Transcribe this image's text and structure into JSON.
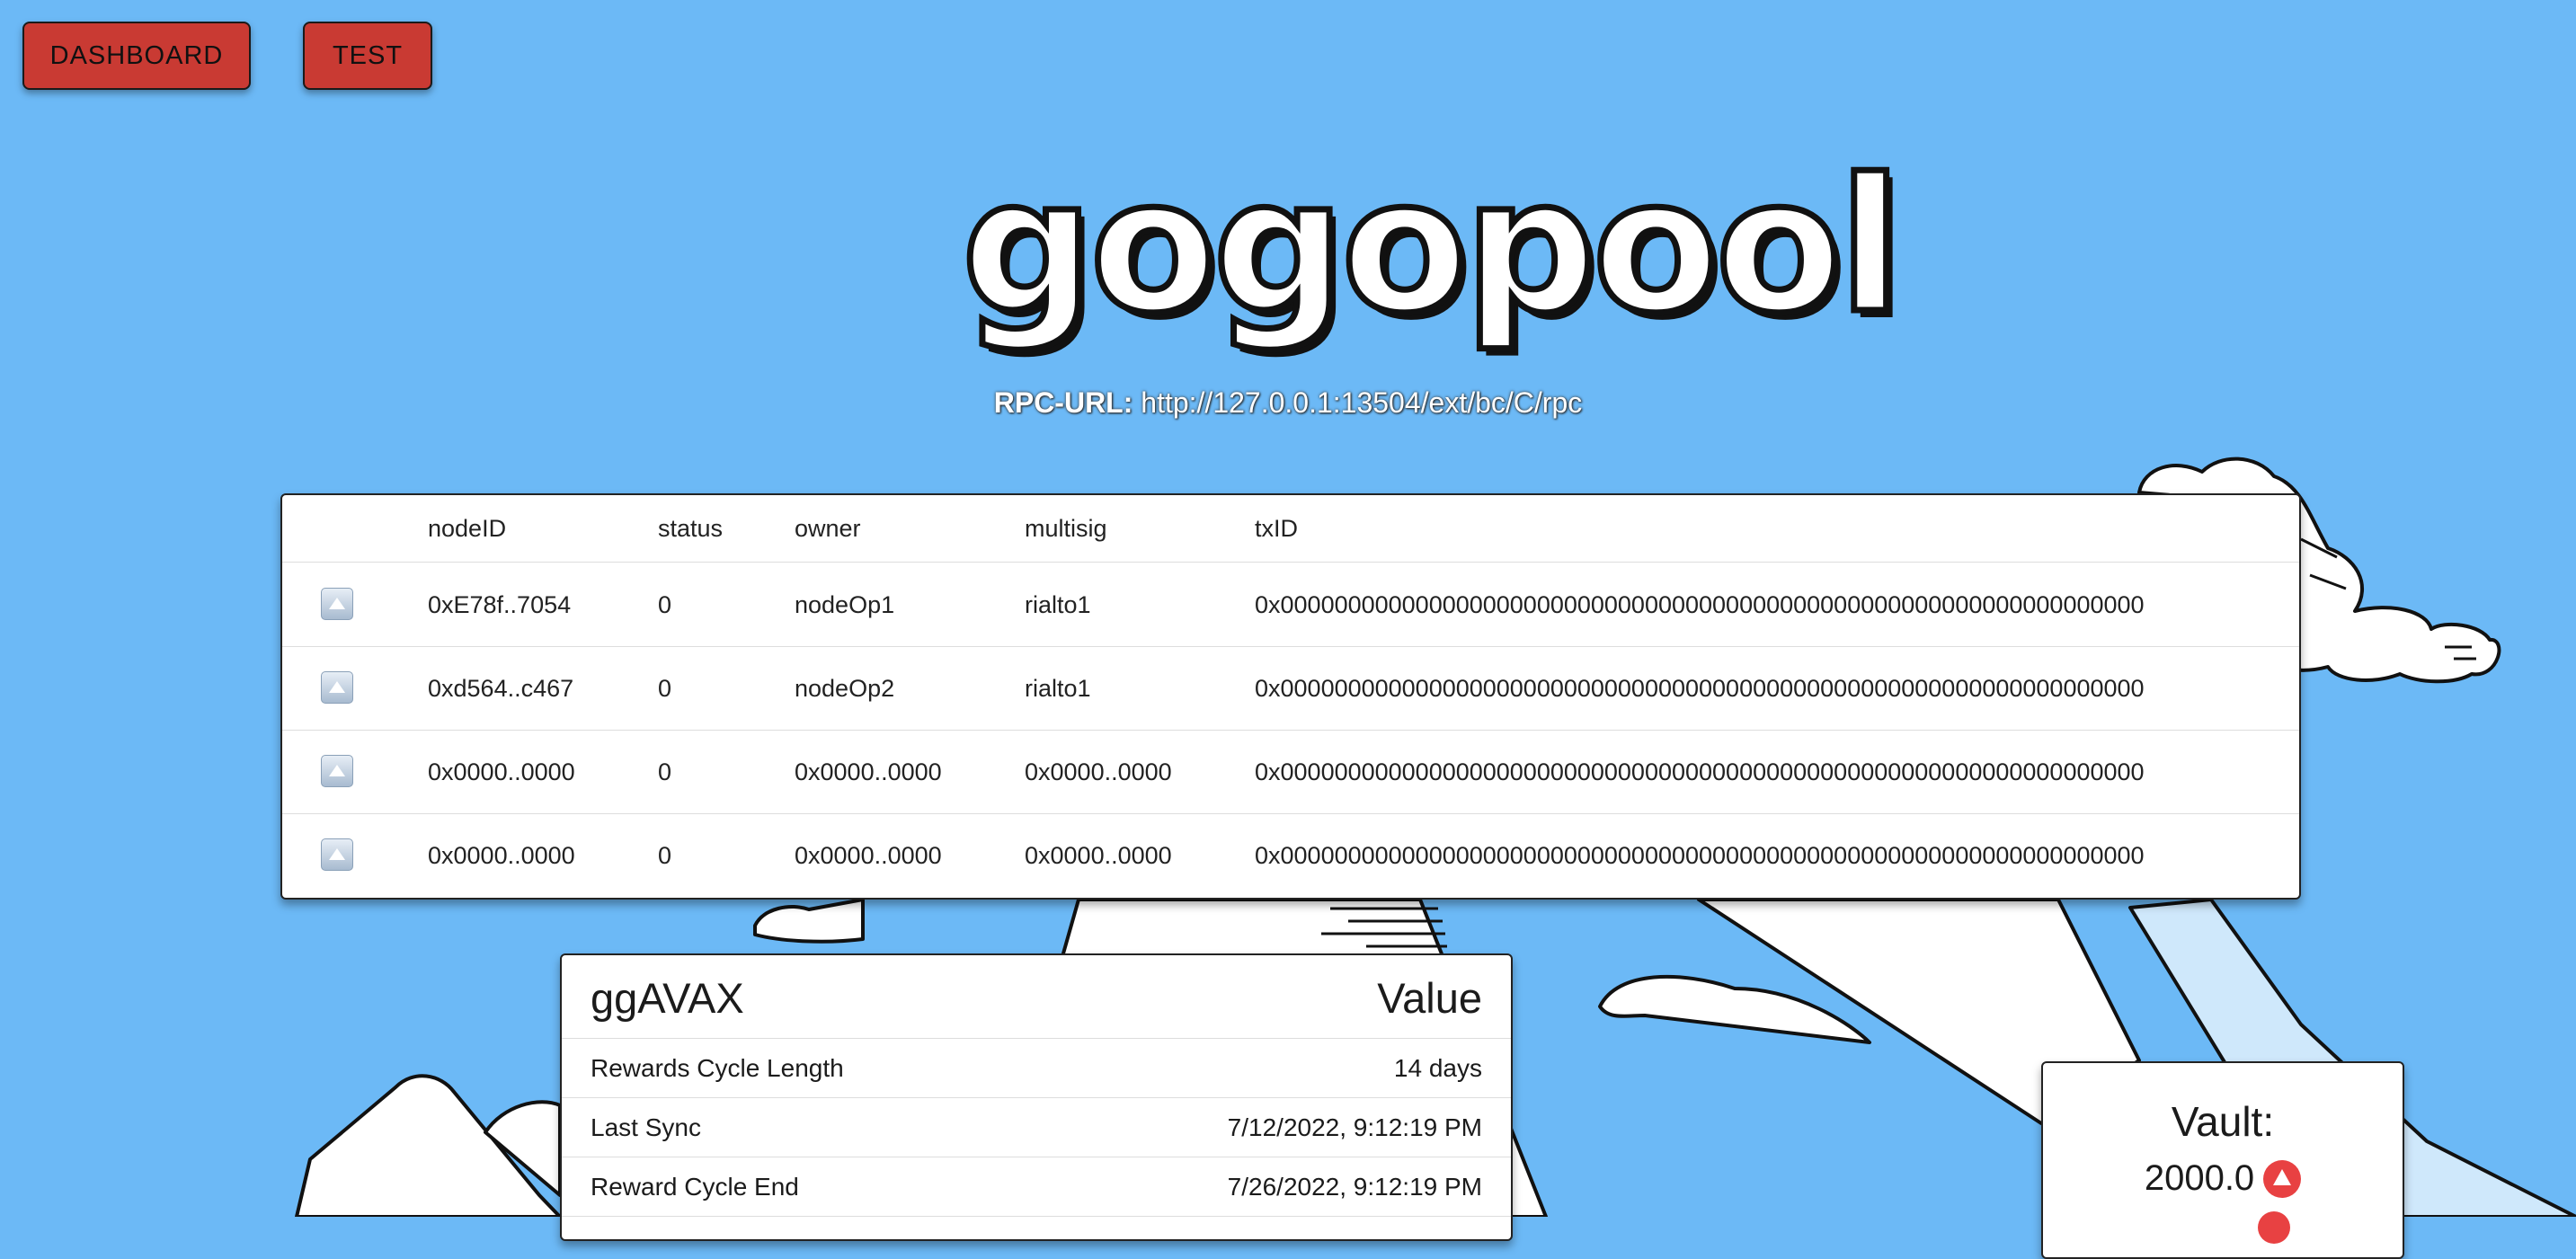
{
  "nav": {
    "dashboard_label": "DASHBOARD",
    "test_label": "TEST"
  },
  "logo": {
    "text": "gogopool"
  },
  "rpc": {
    "label": "RPC-URL:",
    "url": "http://127.0.0.1:13504/ext/bc/C/rpc"
  },
  "nodes_table": {
    "headers": [
      "nodeID",
      "status",
      "owner",
      "multisig",
      "txID"
    ],
    "rows": [
      {
        "nodeID": "0xE78f..7054",
        "status": "0",
        "owner": "nodeOp1",
        "multisig": "rialto1",
        "txID": "0x0000000000000000000000000000000000000000000000000000000000000000"
      },
      {
        "nodeID": "0xd564..c467",
        "status": "0",
        "owner": "nodeOp2",
        "multisig": "rialto1",
        "txID": "0x0000000000000000000000000000000000000000000000000000000000000000"
      },
      {
        "nodeID": "0x0000..0000",
        "status": "0",
        "owner": "0x0000..0000",
        "multisig": "0x0000..0000",
        "txID": "0x0000000000000000000000000000000000000000000000000000000000000000"
      },
      {
        "nodeID": "0x0000..0000",
        "status": "0",
        "owner": "0x0000..0000",
        "multisig": "0x0000..0000",
        "txID": "0x0000000000000000000000000000000000000000000000000000000000000000"
      }
    ]
  },
  "ggavax": {
    "title": "ggAVAX",
    "value_header": "Value",
    "rows": [
      {
        "label": "Rewards Cycle Length",
        "value": "14 days"
      },
      {
        "label": "Last Sync",
        "value": "7/12/2022, 9:12:19 PM"
      },
      {
        "label": "Reward Cycle End",
        "value": "7/26/2022, 9:12:19 PM"
      }
    ]
  },
  "vault": {
    "title": "Vault:",
    "amount": "2000.0",
    "icon": "avax-icon"
  },
  "colors": {
    "background": "#6cb9f6",
    "button": "#c93a33",
    "avax": "#e84142"
  }
}
